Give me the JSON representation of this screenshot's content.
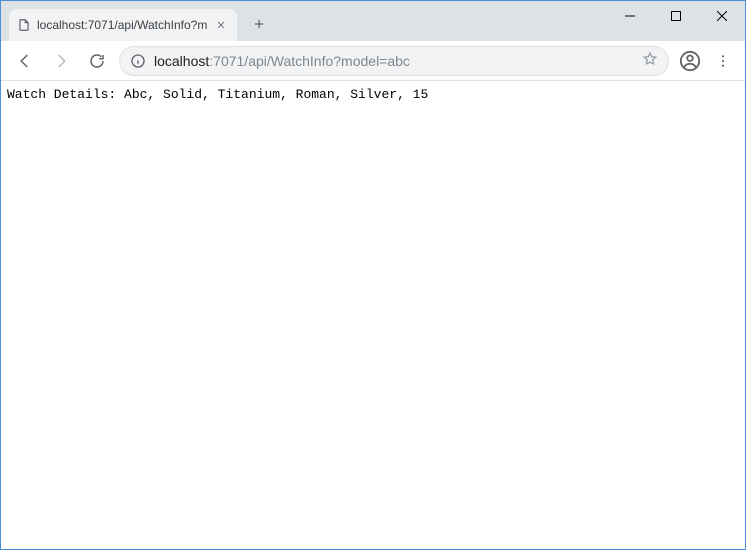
{
  "tab": {
    "title": "localhost:7071/api/WatchInfo?m"
  },
  "address": {
    "host": "localhost",
    "rest": ":7071/api/WatchInfo?model=abc"
  },
  "page": {
    "body_text": "Watch Details: Abc, Solid, Titanium, Roman, Silver, 15"
  }
}
